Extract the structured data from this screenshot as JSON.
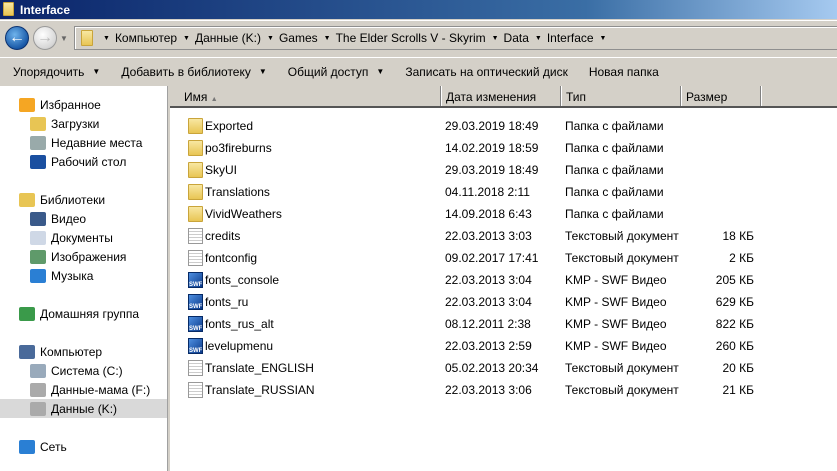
{
  "window": {
    "title": "Interface"
  },
  "breadcrumb": [
    "Компьютер",
    "Данные (K:)",
    "Games",
    "The Elder Scrolls V - Skyrim",
    "Data",
    "Interface"
  ],
  "toolbar": [
    {
      "label": "Упорядочить",
      "menu": true
    },
    {
      "label": "Добавить в библиотеку",
      "menu": true
    },
    {
      "label": "Общий доступ",
      "menu": true
    },
    {
      "label": "Записать на оптический диск",
      "menu": false
    },
    {
      "label": "Новая папка",
      "menu": false
    }
  ],
  "sidebar": [
    {
      "label": "Избранное",
      "level": 0,
      "icon": "star-icon",
      "color": "#f5a623"
    },
    {
      "label": "Загрузки",
      "level": 1,
      "icon": "downloads-icon",
      "color": "#e8c554"
    },
    {
      "label": "Недавние места",
      "level": 1,
      "icon": "recent-places-icon",
      "color": "#9aa"
    },
    {
      "label": "Рабочий стол",
      "level": 1,
      "icon": "desktop-icon",
      "color": "#1a4fa0"
    },
    {
      "label": "Библиотеки",
      "level": 0,
      "icon": "libraries-icon",
      "color": "#e8c554",
      "gap": true
    },
    {
      "label": "Видео",
      "level": 1,
      "icon": "video-icon",
      "color": "#3a5a8a"
    },
    {
      "label": "Документы",
      "level": 1,
      "icon": "documents-icon",
      "color": "#cfd8e6"
    },
    {
      "label": "Изображения",
      "level": 1,
      "icon": "pictures-icon",
      "color": "#5f9a6a"
    },
    {
      "label": "Музыка",
      "level": 1,
      "icon": "music-icon",
      "color": "#2a7fd4"
    },
    {
      "label": "Домашняя группа",
      "level": 0,
      "icon": "homegroup-icon",
      "color": "#3a9a4a",
      "gap": true
    },
    {
      "label": "Компьютер",
      "level": 0,
      "icon": "computer-icon",
      "color": "#4a6a9a",
      "gap": true
    },
    {
      "label": "Система (C:)",
      "level": 1,
      "icon": "drive-icon",
      "color": "#9ab"
    },
    {
      "label": "Данные-мама (F:)",
      "level": 1,
      "icon": "drive-icon",
      "color": "#aaa"
    },
    {
      "label": "Данные (K:)",
      "level": 1,
      "icon": "drive-icon",
      "color": "#aaa",
      "selected": true
    },
    {
      "label": "Сеть",
      "level": 0,
      "icon": "network-icon",
      "color": "#2a7fd4",
      "gap": true
    }
  ],
  "columns": [
    "Имя",
    "Дата изменения",
    "Тип",
    "Размер"
  ],
  "files": [
    {
      "name": "Exported",
      "date": "29.03.2019 18:49",
      "type": "Папка с файлами",
      "size": "",
      "kind": "folder"
    },
    {
      "name": "po3fireburns",
      "date": "14.02.2019 18:59",
      "type": "Папка с файлами",
      "size": "",
      "kind": "folder"
    },
    {
      "name": "SkyUI",
      "date": "29.03.2019 18:49",
      "type": "Папка с файлами",
      "size": "",
      "kind": "folder"
    },
    {
      "name": "Translations",
      "date": "04.11.2018 2:11",
      "type": "Папка с файлами",
      "size": "",
      "kind": "folder"
    },
    {
      "name": "VividWeathers",
      "date": "14.09.2018 6:43",
      "type": "Папка с файлами",
      "size": "",
      "kind": "folder"
    },
    {
      "name": "credits",
      "date": "22.03.2013 3:03",
      "type": "Текстовый документ",
      "size": "18 КБ",
      "kind": "txt"
    },
    {
      "name": "fontconfig",
      "date": "09.02.2017 17:41",
      "type": "Текстовый документ",
      "size": "2 КБ",
      "kind": "txt"
    },
    {
      "name": "fonts_console",
      "date": "22.03.2013 3:04",
      "type": "KMP - SWF Видео",
      "size": "205 КБ",
      "kind": "swf"
    },
    {
      "name": "fonts_ru",
      "date": "22.03.2013 3:04",
      "type": "KMP - SWF Видео",
      "size": "629 КБ",
      "kind": "swf"
    },
    {
      "name": "fonts_rus_alt",
      "date": "08.12.2011 2:38",
      "type": "KMP - SWF Видео",
      "size": "822 КБ",
      "kind": "swf"
    },
    {
      "name": "levelupmenu",
      "date": "22.03.2013 2:59",
      "type": "KMP - SWF Видео",
      "size": "260 КБ",
      "kind": "swf"
    },
    {
      "name": "Translate_ENGLISH",
      "date": "05.02.2013 20:34",
      "type": "Текстовый документ",
      "size": "20 КБ",
      "kind": "txt"
    },
    {
      "name": "Translate_RUSSIAN",
      "date": "22.03.2013 3:06",
      "type": "Текстовый документ",
      "size": "21 КБ",
      "kind": "txt"
    }
  ],
  "swf_badge": "SWF"
}
